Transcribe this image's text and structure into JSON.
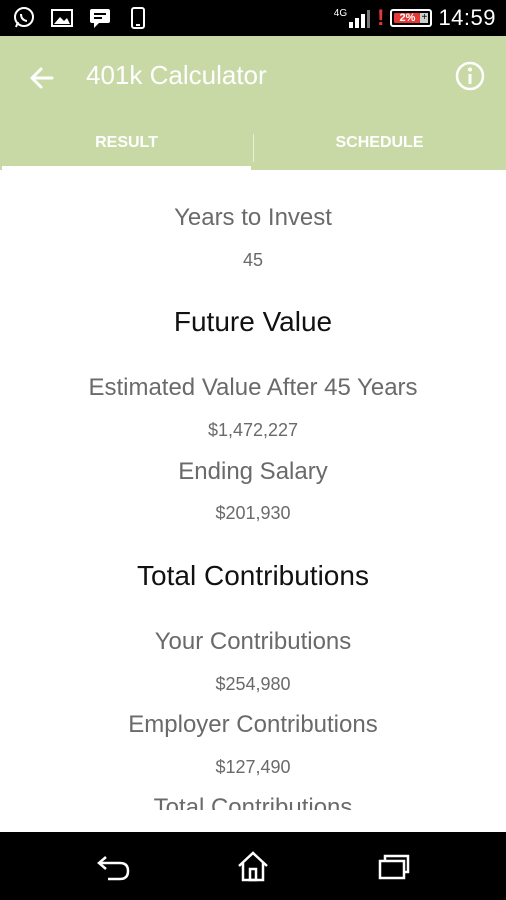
{
  "status_bar": {
    "time": "14:59",
    "battery_text": "2%",
    "network": "4G",
    "icons": [
      "whatsapp-icon",
      "image-icon",
      "chat-icon",
      "phone-icon",
      "signal-icon",
      "warning-icon",
      "battery-icon"
    ]
  },
  "app_bar": {
    "title": "401k Calculator",
    "back_icon": "back-arrow-icon",
    "info_icon": "info-icon",
    "background_color": "#c8d9a6"
  },
  "tabs": [
    {
      "label": "RESULT",
      "active": true
    },
    {
      "label": "SCHEDULE",
      "active": false
    }
  ],
  "result": {
    "years_label": "Years to Invest",
    "years_value": "45",
    "future_value_heading": "Future Value",
    "estimated_label": "Estimated Value After 45 Years",
    "estimated_value": "$1,472,227",
    "ending_salary_label": "Ending Salary",
    "ending_salary_value": "$201,930",
    "total_contributions_heading": "Total Contributions",
    "your_contributions_label": "Your Contributions",
    "your_contributions_value": "$254,980",
    "employer_contributions_label": "Employer Contributions",
    "employer_contributions_value": "$127,490",
    "total_contributions_label": "Total Contributions"
  },
  "nav_bar": {
    "buttons": [
      "back-nav-icon",
      "home-icon",
      "recent-apps-icon"
    ]
  }
}
